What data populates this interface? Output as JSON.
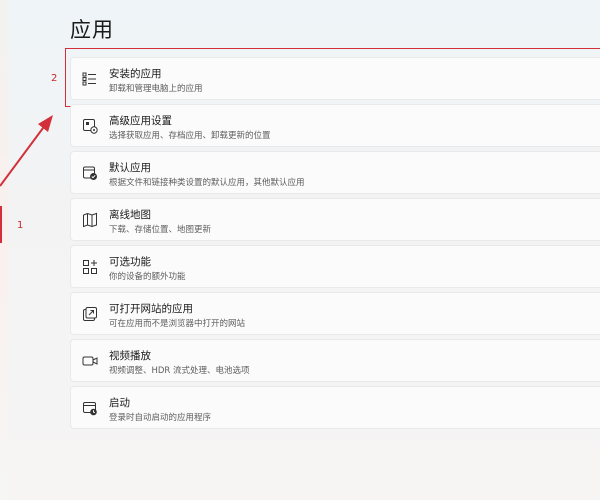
{
  "page": {
    "title": "应用"
  },
  "markers": {
    "step1": "1",
    "step2": "2"
  },
  "colors": {
    "annotation": "#d32f3a",
    "card_bg": "#fbfbfb",
    "page_bg": "#f3f3f4"
  },
  "settings_items": [
    {
      "title": "安装的应用",
      "description": "卸载和管理电脑上的应用",
      "icon": "list-icon"
    },
    {
      "title": "高级应用设置",
      "description": "选择获取应用、存档应用、卸载更新的位置",
      "icon": "app-settings-icon"
    },
    {
      "title": "默认应用",
      "description": "根据文件和链接种类设置的默认应用，其他默认应用",
      "icon": "default-apps-icon"
    },
    {
      "title": "离线地图",
      "description": "下载、存储位置、地图更新",
      "icon": "map-icon"
    },
    {
      "title": "可选功能",
      "description": "你的设备的额外功能",
      "icon": "grid-plus-icon"
    },
    {
      "title": "可打开网站的应用",
      "description": "可在应用而不是浏览器中打开的网站",
      "icon": "open-link-icon"
    },
    {
      "title": "视频播放",
      "description": "视频调整、HDR 流式处理、电池选项",
      "icon": "video-icon"
    },
    {
      "title": "启动",
      "description": "登录时自动启动的应用程序",
      "icon": "startup-icon"
    }
  ]
}
